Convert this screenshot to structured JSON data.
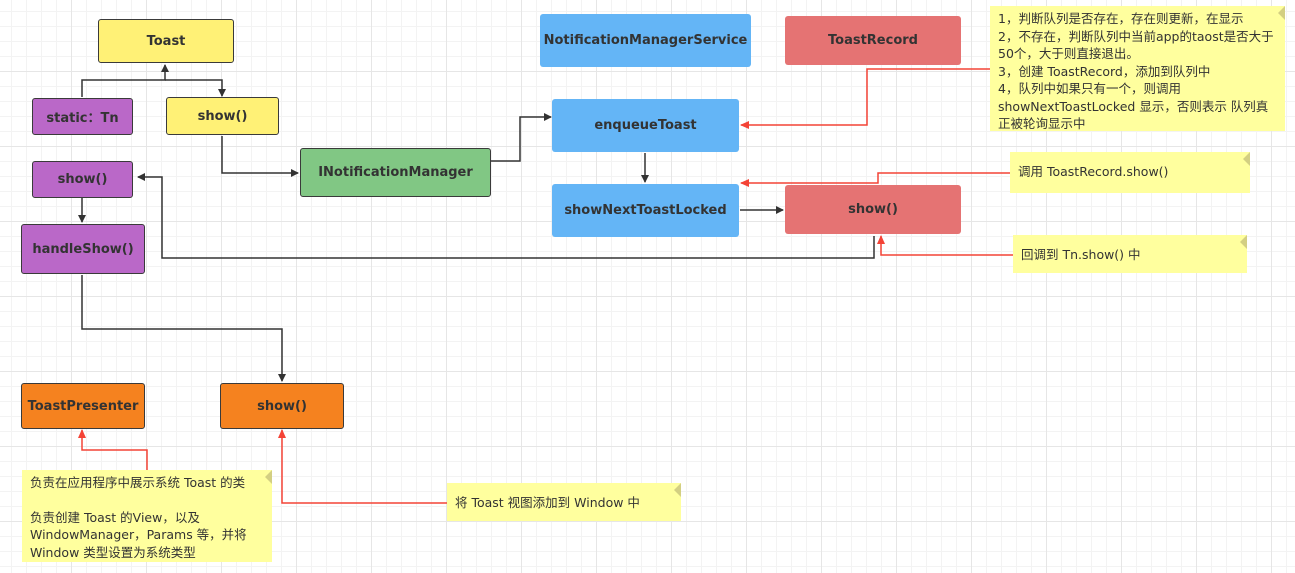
{
  "nodes": {
    "toast": "Toast",
    "static_tn": "static：Tn",
    "toast_show": "show()",
    "inotification_manager": "INotificationManager",
    "notification_manager_service": "NotificationManagerService",
    "toast_record": "ToastRecord",
    "enqueue_toast": "enqueueToast",
    "show_next_toast_locked": "showNextToastLocked",
    "toast_record_show": "show()",
    "tn_show": "show()",
    "handle_show": "handleShow()",
    "toast_presenter": "ToastPresenter",
    "presenter_show": "show()"
  },
  "notes": {
    "enqueue_note": [
      "1，判断队列是否存在，存在则更新，在显示",
      "2，不存在，判断队列中当前app的taost是否大于 50个，大于则直接退出。",
      "3，创建 ToastRecord，添加到队列中",
      "4，队列中如果只有一个，则调用 showNextToastLocked 显示，否则表示 队列真正被轮询显示中"
    ],
    "record_show_note": "调用 ToastRecord.show()",
    "callback_note": "回调到 Tn.show() 中",
    "presenter_note": [
      "负责在应用程序中展示系统 Toast 的类",
      "",
      "负责创建 Toast 的View，以及 WindowManager，Params 等，并将 Window 类型设置为系统类型"
    ],
    "add_window_note": "将 Toast 视图添加到 Window 中"
  },
  "colors": {
    "edge": "#333333",
    "annotation_edge": "#f44336",
    "note_bg": "#ffff9e",
    "yellow": "#fff176",
    "purple": "#ba68c8",
    "green": "#81c784",
    "blue": "#64b5f6",
    "red": "#e57373",
    "orange": "#f5821f"
  }
}
